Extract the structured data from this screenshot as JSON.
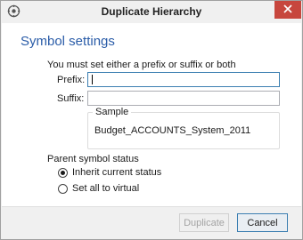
{
  "window": {
    "title": "Duplicate Hierarchy",
    "icons": {
      "app": "settings-gear-icon",
      "close": "close-icon"
    }
  },
  "header": {
    "title": "Symbol settings"
  },
  "form": {
    "instruction": "You must set either a prefix or suffix or both",
    "prefix": {
      "label": "Prefix:",
      "value": ""
    },
    "suffix": {
      "label": "Suffix:",
      "value": ""
    },
    "sample": {
      "label": "Sample",
      "value": "Budget_ACCOUNTS_System_2011"
    }
  },
  "status": {
    "label": "Parent symbol status",
    "options": [
      {
        "label": "Inherit current status",
        "selected": true
      },
      {
        "label": "Set all to virtual",
        "selected": false
      }
    ]
  },
  "buttons": {
    "duplicate": {
      "label": "Duplicate",
      "enabled": false
    },
    "cancel": {
      "label": "Cancel"
    }
  },
  "colors": {
    "heading": "#2a5ca8",
    "close_button": "#c7463d",
    "focus_border": "#3c7fb1"
  }
}
